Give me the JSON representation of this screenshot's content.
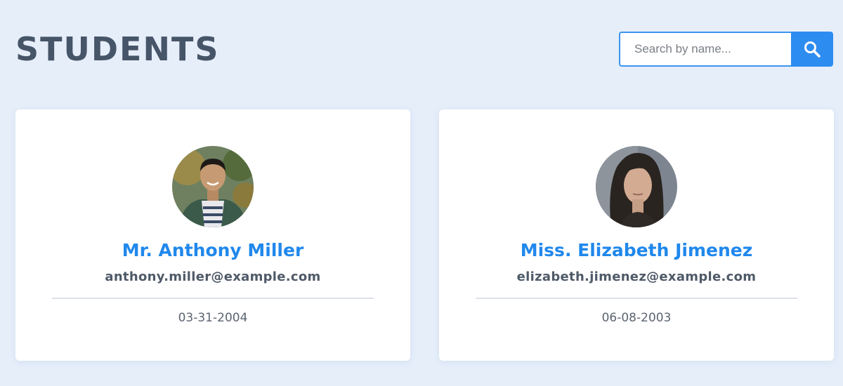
{
  "header": {
    "title": "STUDENTS"
  },
  "search": {
    "placeholder": "Search by name...",
    "icon": "search-icon"
  },
  "students": [
    {
      "name": "Mr. Anthony Miller",
      "email": "anthony.miller@example.com",
      "dob": "03-31-2004",
      "avatar": "avatar-man"
    },
    {
      "name": "Miss. Elizabeth Jimenez",
      "email": "elizabeth.jimenez@example.com",
      "dob": "06-08-2003",
      "avatar": "avatar-woman"
    }
  ],
  "colors": {
    "accent": "#2d8cf0",
    "background": "#e6eefa",
    "title": "#475569"
  }
}
